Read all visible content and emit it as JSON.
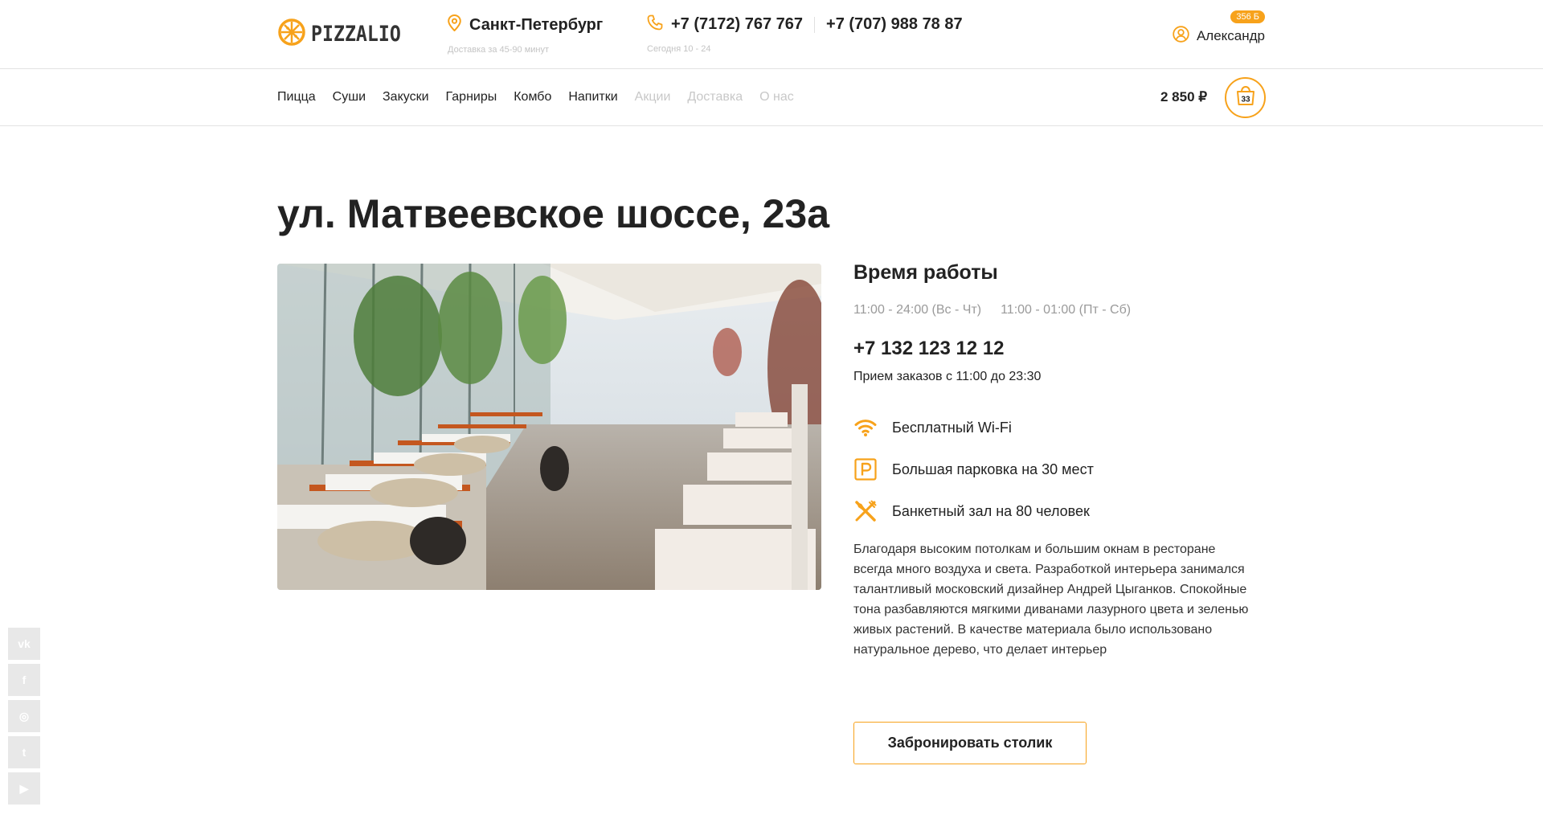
{
  "header": {
    "logo_text": "PIZZALIO",
    "city": "Санкт-Петербург",
    "delivery_note": "Доставка за 45-90 минут",
    "phones": [
      "+7 (7172) 767 767",
      "+7 (707) 988 78 87"
    ],
    "hours_note": "Сегодня 10 - 24",
    "user": {
      "name": "Александр",
      "bonus": "356 Б"
    }
  },
  "nav": {
    "items": [
      {
        "label": "Пицца",
        "muted": false
      },
      {
        "label": "Суши",
        "muted": false
      },
      {
        "label": "Закуски",
        "muted": false
      },
      {
        "label": "Гарниры",
        "muted": false
      },
      {
        "label": "Комбо",
        "muted": false
      },
      {
        "label": "Напитки",
        "muted": false
      },
      {
        "label": "Акции",
        "muted": true
      },
      {
        "label": "Доставка",
        "muted": true
      },
      {
        "label": "О нас",
        "muted": true
      }
    ],
    "cart_total": "2 850 ₽",
    "cart_count": "33"
  },
  "page": {
    "title": "ул. Матвеевское шоссе, 23а",
    "hours_title": "Время работы",
    "hours": [
      "11:00 - 24:00 (Вс - Чт)",
      "11:00 - 01:00 (Пт - Сб)"
    ],
    "phone": "+7 132 123 12 12",
    "order_time": "Прием заказов с 11:00 до 23:30",
    "features": [
      {
        "icon": "wifi-icon",
        "label": "Бесплатный Wi-Fi"
      },
      {
        "icon": "parking-icon",
        "label": "Большая парковка на 30 мест"
      },
      {
        "icon": "fork-knife-icon",
        "label": "Банкетный зал на 80 человек"
      }
    ],
    "description": "Благодаря высоким потолкам и большим окнам в ресторане всегда много воздуха и света. Разработкой интерьера занимался талантливый московский дизайнер Андрей Цыганков. Спокойные тона разбавляются мягкими диванами лазурного цвета и зеленью живых растений. В качестве материала было использовано натуральное дерево, что делает интерьер",
    "book_button": "Забронировать столик"
  },
  "socials": [
    {
      "icon": "vk-icon",
      "glyph": "vk"
    },
    {
      "icon": "facebook-icon",
      "glyph": "f"
    },
    {
      "icon": "instagram-icon",
      "glyph": "◎"
    },
    {
      "icon": "twitter-icon",
      "glyph": "t"
    },
    {
      "icon": "youtube-icon",
      "glyph": "▶"
    }
  ],
  "colors": {
    "accent": "#f7a21b",
    "text": "#222222",
    "muted": "#c8c8c8",
    "social_bg": "#e8e8e8"
  }
}
